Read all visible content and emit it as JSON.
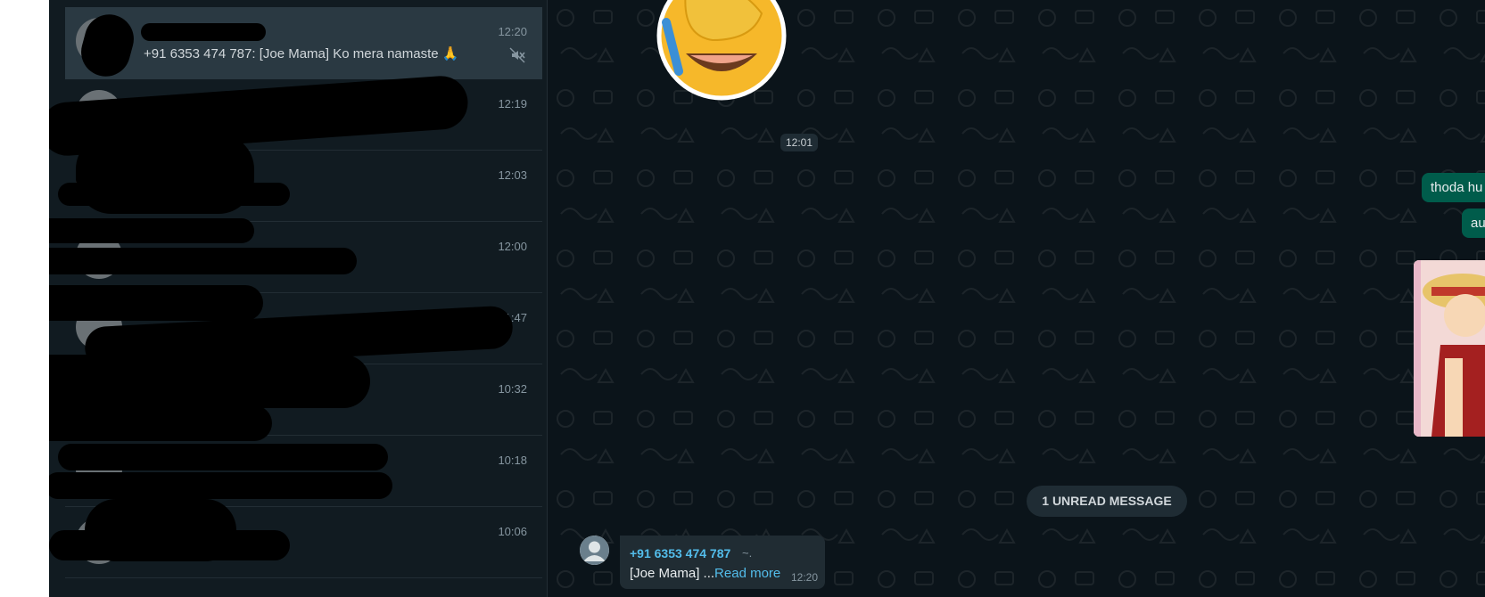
{
  "sidebar": {
    "chats": [
      {
        "time": "12:20",
        "preview": "+91 6353 474 787: [Joe Mama] Ko mera namaste",
        "preview_emoji": "🙏",
        "muted": true
      },
      {
        "time": "12:19"
      },
      {
        "time": "12:03"
      },
      {
        "time": "12:00"
      },
      {
        "time": "11:47"
      },
      {
        "time": "10:32"
      },
      {
        "time": "10:18"
      },
      {
        "time": "10:06"
      }
    ]
  },
  "conversation": {
    "sticker_time": "12:01",
    "outgoing": [
      {
        "text": "thoda hu"
      },
      {
        "text": "au"
      }
    ],
    "unread_label": "1 UNREAD MESSAGE",
    "incoming": {
      "sender": "+91 6353 474 787",
      "sender_tag": "~.",
      "body": "[Joe Mama] ...",
      "read_more": "Read more",
      "time": "12:20"
    }
  },
  "colors": {
    "sidebar_bg": "#111b21",
    "active_row": "#2a3942",
    "chat_bg": "#0b141a",
    "outgoing_bubble": "#005c4b",
    "incoming_bubble": "#202c33",
    "link": "#53bdeb"
  },
  "icons": [
    "mute-icon",
    "default-avatar-icon",
    "facepalm-laughing-sticker"
  ]
}
